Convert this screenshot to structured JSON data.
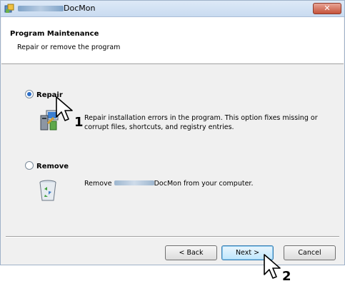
{
  "window": {
    "title": "DocMon",
    "close_label": "✕"
  },
  "header": {
    "title": "Program Maintenance",
    "subtitle": "Repair or remove the program"
  },
  "options": [
    {
      "label": "Repair",
      "selected": true,
      "description_line1": "Repair installation errors in the program. This option fixes missing or",
      "description_line2": "corrupt files, shortcuts, and registry entries.",
      "icon": "repair-computer-icon"
    },
    {
      "label": "Remove",
      "selected": false,
      "description_prefix": "Remove",
      "description_suffix": "DocMon from your computer.",
      "icon": "recycle-bin-icon"
    }
  ],
  "buttons": {
    "back": "< Back",
    "next": "Next >",
    "cancel": "Cancel"
  },
  "steps": {
    "step1": "1",
    "step2": "2"
  },
  "colors": {
    "titlebar": "#c9dbf0",
    "close_button": "#c5533b",
    "radio_selected": "#2c6ec7",
    "default_button": "#bee6fd"
  }
}
